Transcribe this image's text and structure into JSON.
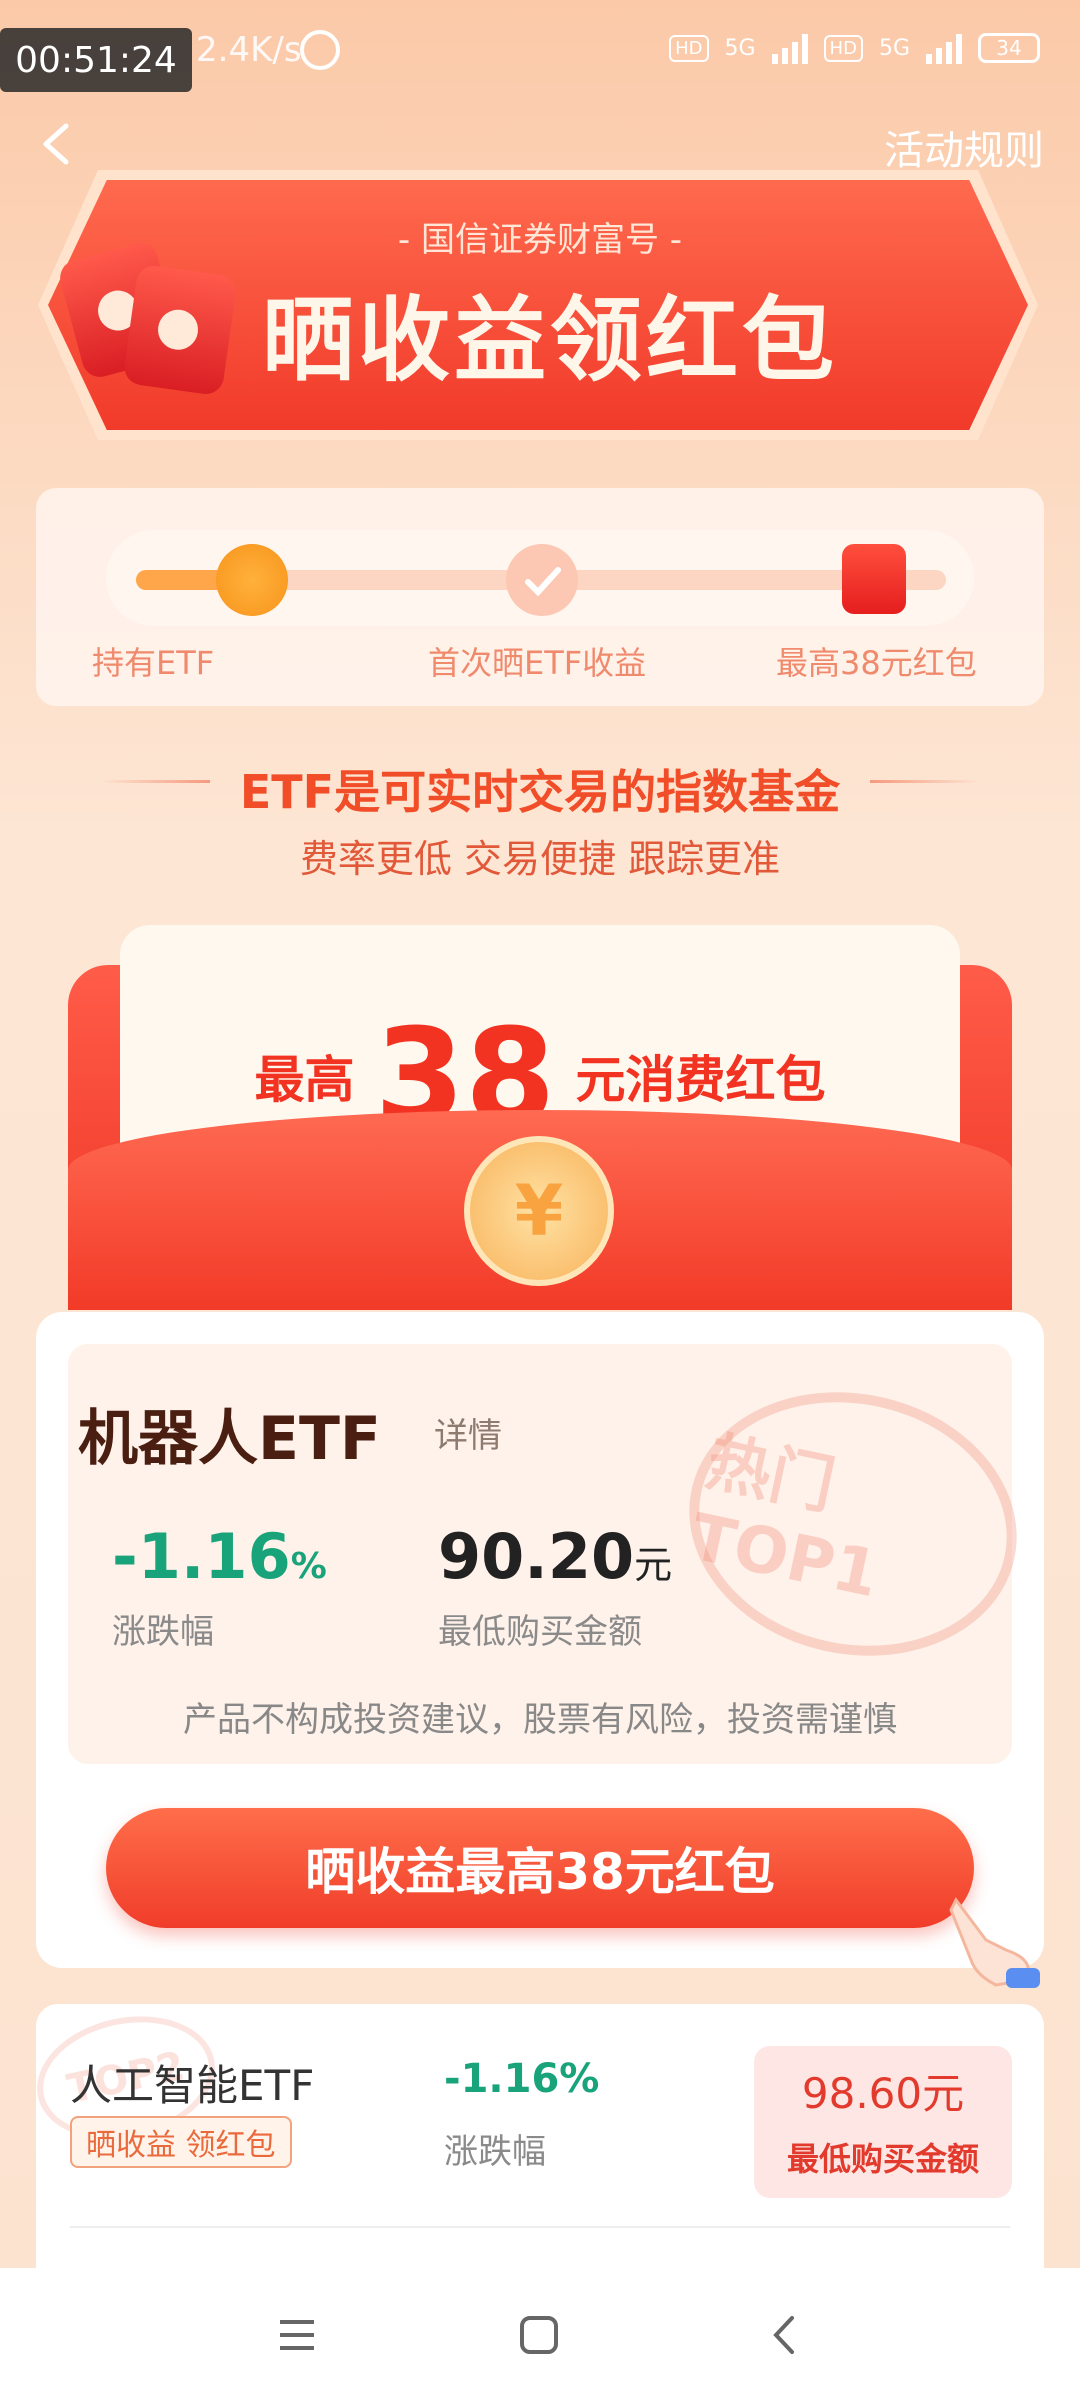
{
  "status_bar": {
    "timer": "00:51:24",
    "net_speed": "2.4K/s",
    "battery": "34",
    "network_1": "5G",
    "network_2": "5G",
    "hd_1": "HD",
    "hd_2": "HD"
  },
  "nav": {
    "rules_label": "活动规则"
  },
  "banner": {
    "subtitle": "- 国信证券财富号 -",
    "title": "晒收益领红包"
  },
  "steps": [
    {
      "label": "持有ETF"
    },
    {
      "label": "首次晒ETF收益"
    },
    {
      "label": "最高38元红包"
    }
  ],
  "headline": "ETF是可实时交易的指数基金",
  "subline": "费率更低  交易便捷  跟踪更准",
  "envelope": {
    "prefix": "最高",
    "amount": "38",
    "suffix": "元消费红包",
    "coin_symbol": "¥"
  },
  "featured": {
    "name": "机器人ETF",
    "detail_label": "详情",
    "stamp_text": "热门TOP1",
    "change": "-1.16",
    "change_unit": "%",
    "change_label": "涨跌幅",
    "price": "90.20",
    "price_unit": "元",
    "price_label": "最低购买金额",
    "disclaimer": "产品不构成投资建议，股票有风险，投资需谨慎",
    "cta_label": "晒收益最高38元红包"
  },
  "list": [
    {
      "name": "人工智能ETF",
      "badge": "晒收益 领红包",
      "stamp_text": "TOP2",
      "change": "-1.16%",
      "change_label": "涨跌幅",
      "price": "98.60元",
      "price_label": "最低购买金额"
    }
  ],
  "colors": {
    "accent_red": "#f03d2a",
    "gain_green": "#18a37a",
    "background": "#fde6d4"
  }
}
